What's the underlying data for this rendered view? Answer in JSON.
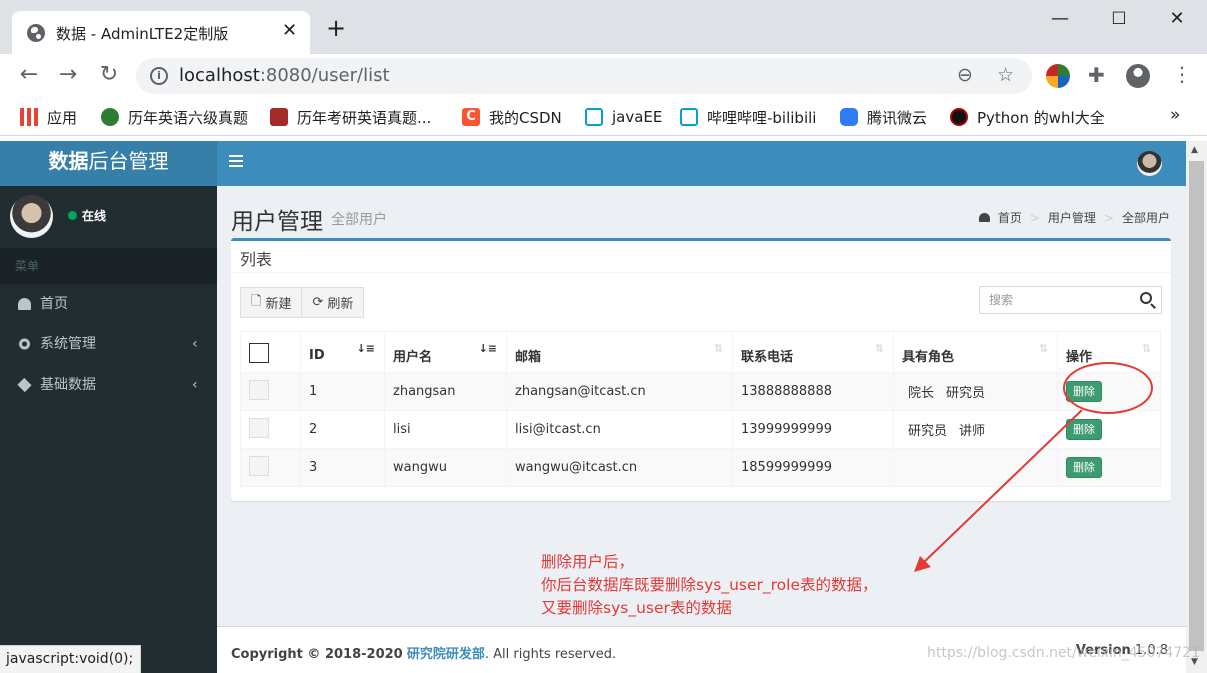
{
  "browser": {
    "tab_title": "数据 - AdminLTE2定制版",
    "url_host": "localhost",
    "url_rest": ":8080/user/list",
    "bookmarks": [
      {
        "label": "应用",
        "icon": "apps-grid-icon",
        "color": "#4285f4"
      },
      {
        "label": "历年英语六级真题",
        "icon": "bookmark-site-icon",
        "color": "#2e7d32"
      },
      {
        "label": "历年考研英语真题...",
        "icon": "book-icon",
        "color": "#a52a2a"
      },
      {
        "label": "我的CSDN",
        "icon": "csdn-icon",
        "color": "#fc5531"
      },
      {
        "label": "javaEE",
        "icon": "bilibili-icon",
        "color": "#00a1d6"
      },
      {
        "label": "哔哩哔哩-bilibili",
        "icon": "bilibili-icon",
        "color": "#00a1d6"
      },
      {
        "label": "腾讯微云",
        "icon": "cloud-icon",
        "color": "#2f7bf5"
      },
      {
        "label": "Python 的whl大全",
        "icon": "python-whl-icon",
        "color": "#b00000"
      }
    ],
    "bookmarks_overflow": "»",
    "status_text": "javascript:void(0);"
  },
  "app": {
    "logo_bold": "数据",
    "logo_rest": "后台管理",
    "online": "在线",
    "menu_header": "菜单",
    "menu": [
      {
        "label": "首页",
        "icon": "dashboard-icon",
        "chevron": ""
      },
      {
        "label": "系统管理",
        "icon": "cogs-icon",
        "chevron": "‹"
      },
      {
        "label": "基础数据",
        "icon": "cube-icon",
        "chevron": "‹"
      }
    ]
  },
  "content": {
    "title": "用户管理",
    "subtitle": "全部用户",
    "breadcrumb": [
      "首页",
      "用户管理",
      "全部用户"
    ],
    "box_title": "列表",
    "new_label": "新建",
    "refresh_label": "刷新",
    "search_placeholder": "搜索",
    "columns": [
      "ID",
      "用户名",
      "邮箱",
      "联系电话",
      "具有角色",
      "操作"
    ],
    "rows": [
      {
        "id": "1",
        "username": "zhangsan",
        "email": "zhangsan@itcast.cn",
        "phone": "13888888888",
        "roles": [
          "院长",
          "研究员"
        ],
        "action": "删除"
      },
      {
        "id": "2",
        "username": "lisi",
        "email": "lisi@itcast.cn",
        "phone": "13999999999",
        "roles": [
          "研究员",
          "讲师"
        ],
        "action": "删除"
      },
      {
        "id": "3",
        "username": "wangwu",
        "email": "wangwu@itcast.cn",
        "phone": "18599999999",
        "roles": [],
        "action": "删除"
      }
    ]
  },
  "annotation": {
    "lines": [
      "删除用户后，",
      "你后台数据库既要删除sys_user_role表的数据，",
      "又要删除sys_user表的数据"
    ],
    "color": "#e53935"
  },
  "footer": {
    "copyright_prefix": "Copyright © 2018-2020",
    "org": "研究院研发部",
    "suffix": ". All rights reserved.",
    "version_label": "Version",
    "version": "1.0.8"
  },
  "watermark": "https://blog.csdn.net/weixin_45074721",
  "colors": {
    "accent": "#3c8dbc",
    "sidebar": "#222d32",
    "delete_button": "#3c9b6f"
  }
}
